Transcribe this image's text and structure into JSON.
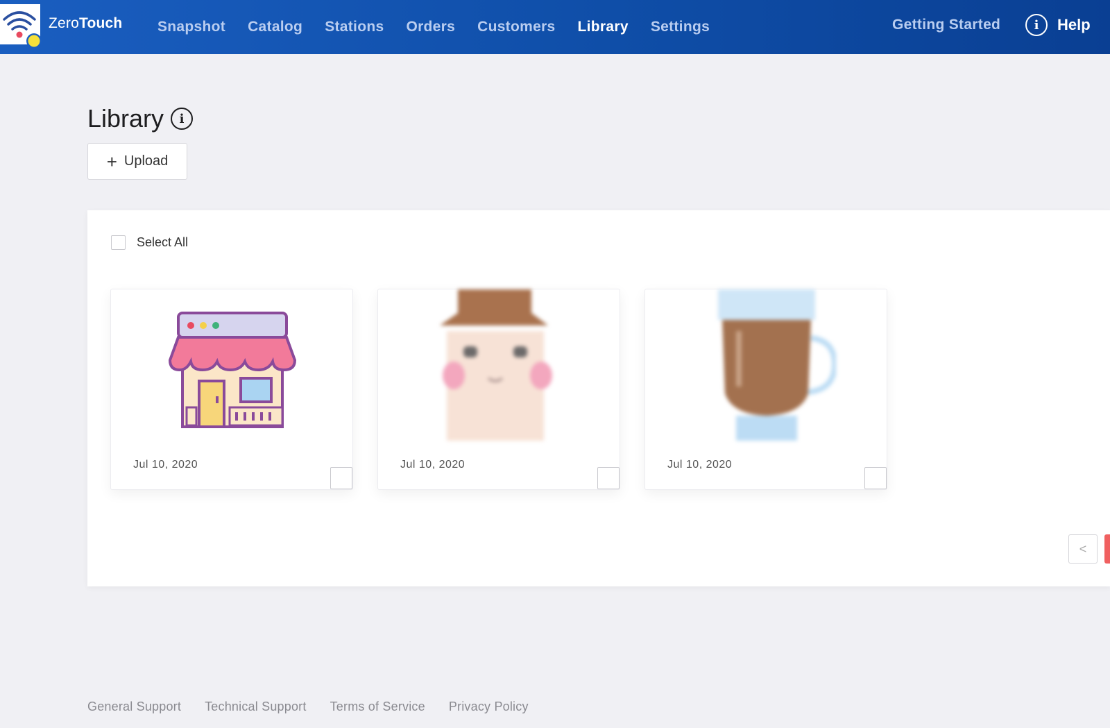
{
  "header": {
    "brand_part1": "Zero",
    "brand_part2": "Touch",
    "nav": [
      {
        "label": "Snapshot"
      },
      {
        "label": "Catalog"
      },
      {
        "label": "Stations"
      },
      {
        "label": "Orders"
      },
      {
        "label": "Customers"
      },
      {
        "label": "Library",
        "active": true
      },
      {
        "label": "Settings"
      }
    ],
    "getting_started": "Getting Started",
    "help": "Help",
    "colors": {
      "bar": "#0f4ea8",
      "logo_dot_red": "#e84a5f",
      "logo_dot_yellow": "#f5e03a"
    }
  },
  "page": {
    "title": "Library",
    "upload_label": "Upload",
    "upload_icon": "plus-icon",
    "info_icon": "info-circle-icon"
  },
  "library": {
    "select_all_label": "Select All",
    "items": [
      {
        "image": "storefront-icon",
        "date": "Jul 10, 2020"
      },
      {
        "image": "chef-character-icon",
        "date": "Jul 10, 2020"
      },
      {
        "image": "coffee-glass-icon",
        "date": "Jul 10, 2020"
      }
    ]
  },
  "pagination": {
    "prev_symbol": "<",
    "accent_color": "#f06060"
  },
  "footer": {
    "links": [
      "General Support",
      "Technical Support",
      "Terms of Service",
      "Privacy Policy"
    ]
  }
}
